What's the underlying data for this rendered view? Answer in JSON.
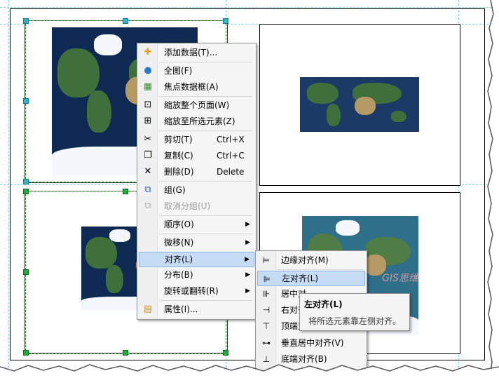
{
  "context_menu": {
    "items": [
      {
        "label": "添加数据(T)...",
        "icon": "add-data-icon"
      },
      {
        "label": "全图(F)",
        "icon": "full-extent-icon"
      },
      {
        "label": "焦点数据框(A)",
        "icon": "focus-data-frame-icon"
      },
      {
        "label": "缩放整个页面(W)",
        "icon": "zoom-whole-page-icon"
      },
      {
        "label": "缩放至所选元素(Z)",
        "icon": "zoom-to-selected-icon"
      },
      {
        "label": "剪切(T)",
        "shortcut": "Ctrl+X",
        "icon": "cut-icon"
      },
      {
        "label": "复制(C)",
        "shortcut": "Ctrl+C",
        "icon": "copy-icon"
      },
      {
        "label": "删除(D)",
        "shortcut": "Delete",
        "icon": "delete-icon"
      },
      {
        "label": "组(G)",
        "icon": "group-icon"
      },
      {
        "label": "取消分组(U)",
        "icon": "ungroup-icon",
        "disabled": true
      },
      {
        "label": "顺序(O)",
        "submenu": true
      },
      {
        "label": "微移(N)",
        "submenu": true
      },
      {
        "label": "对齐(L)",
        "submenu": true,
        "highlighted": true
      },
      {
        "label": "分布(B)",
        "submenu": true
      },
      {
        "label": "旋转或翻转(R)",
        "submenu": true
      },
      {
        "label": "属性(I)...",
        "icon": "properties-icon"
      }
    ]
  },
  "align_submenu": {
    "items": [
      {
        "label": "边缘对齐(M)",
        "icon": "align-to-margins-icon"
      },
      {
        "label": "左对齐(L)",
        "icon": "align-left-icon",
        "highlighted": true
      },
      {
        "label": "居中对",
        "icon": "align-center-icon"
      },
      {
        "label": "右对齐",
        "icon": "align-right-icon"
      },
      {
        "label": "顶端对",
        "icon": "align-top-icon"
      },
      {
        "label": "垂直居中对齐(V)",
        "icon": "align-vertical-center-icon"
      },
      {
        "label": "底端对齐(B)",
        "icon": "align-bottom-icon"
      }
    ]
  },
  "tooltip": {
    "title": "左对齐(L)",
    "description": "将所选元素靠左侧对齐。"
  },
  "watermark": "GIS思维",
  "colors": {
    "selection": "#1fae3a",
    "guide": "#7fd6e8",
    "menu_highlight": "#c5dcf4",
    "ocean_dark": "#0e2a52",
    "ocean_light": "#2e6f8a"
  }
}
